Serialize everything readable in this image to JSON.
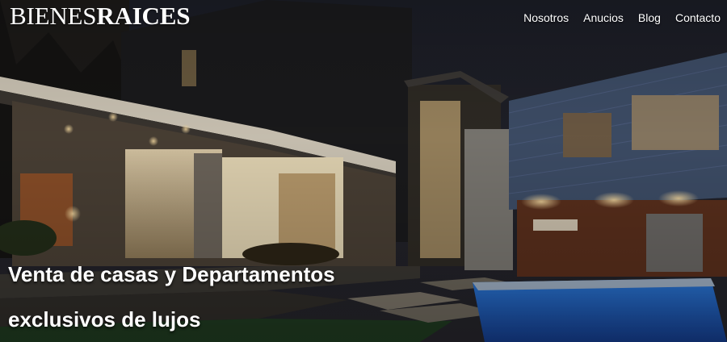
{
  "logo": {
    "light": "BIENES",
    "bold": "RAICES"
  },
  "nav": [
    "Nosotros",
    "Anucios",
    "Blog",
    "Contacto"
  ],
  "hero": {
    "headline_line1": "Venta de casas y Departamentos",
    "headline_line2": "exclusivos de lujos"
  },
  "colors": {
    "text": "#ffffff",
    "sky": "#15161c",
    "pool": "#1f5fb8"
  }
}
